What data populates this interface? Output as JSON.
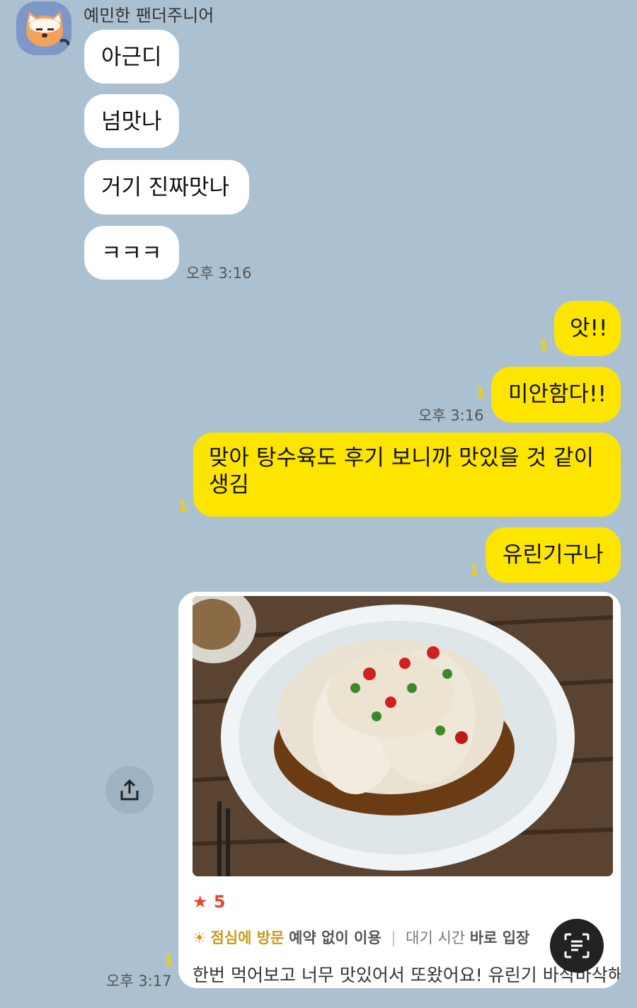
{
  "sender": {
    "name": "예민한 팬더주니어",
    "avatar_icon": "red-panda-avatar"
  },
  "incoming": [
    {
      "text": "아근디"
    },
    {
      "text": "넘맛나"
    },
    {
      "text": "거기 진짜맛나"
    },
    {
      "text": "ㅋㅋㅋ"
    }
  ],
  "incoming_time": "오후 3:16",
  "outgoing": [
    {
      "text": "앗!!",
      "unread": "1"
    },
    {
      "text": "미안함다!!",
      "unread": "1",
      "time": "오후 3:16"
    },
    {
      "text": "맞아 탕수육도 후기 보니까 맛있을 것 같이 생김",
      "unread": "1"
    },
    {
      "text": "유린기구나",
      "unread": "1"
    }
  ],
  "shared_card": {
    "rating": "5",
    "tags": {
      "visit": "점심에 방문",
      "reservation": "예약 없이 이용",
      "wait_label": "대기 시간",
      "wait_value": "바로 입장"
    },
    "review": "한번 먹어보고 너무 맛있어서 또왔어요! 유린기 바삭바삭해",
    "unread": "1",
    "time": "오후 3:17"
  },
  "colors": {
    "background": "#abc1d1",
    "outgoing_bubble": "#fee500",
    "incoming_bubble": "#ffffff",
    "unread": "#f2d000"
  },
  "icons": {
    "share": "share-icon",
    "text_scan": "text-scan-icon",
    "star": "star-icon",
    "sun": "sun-icon"
  }
}
